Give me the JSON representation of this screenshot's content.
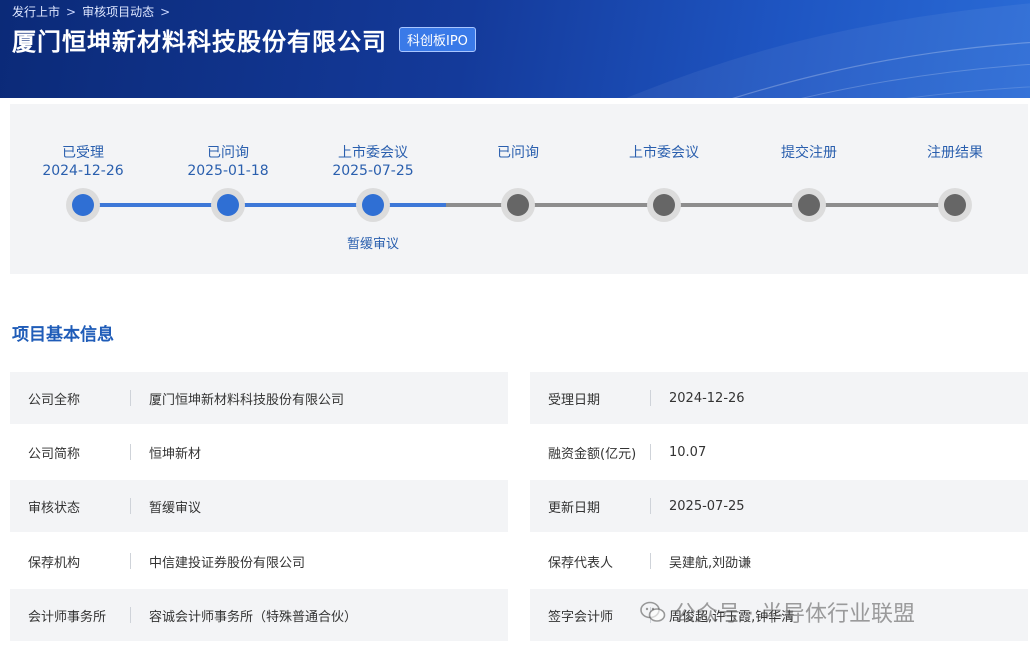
{
  "breadcrumb": [
    "发行上市",
    "审核项目动态"
  ],
  "header": {
    "company_name": "厦门恒坤新材料科技股份有限公司",
    "board_tag": "科创板IPO"
  },
  "timeline": {
    "steps": [
      {
        "label": "已受理",
        "date": "2024-12-26",
        "status": "done"
      },
      {
        "label": "已问询",
        "date": "2025-01-18",
        "status": "done"
      },
      {
        "label": "上市委会议",
        "date": "2025-07-25",
        "status": "done",
        "note": "暂缓审议"
      },
      {
        "label": "已问询",
        "date": "",
        "status": "todo"
      },
      {
        "label": "上市委会议",
        "date": "",
        "status": "todo"
      },
      {
        "label": "提交注册",
        "date": "",
        "status": "todo"
      },
      {
        "label": "注册结果",
        "date": "",
        "status": "todo"
      }
    ],
    "colors": {
      "done": "#2f6fd4",
      "todo": "#666666"
    }
  },
  "section": {
    "title": "项目基本信息"
  },
  "info": {
    "left": [
      {
        "key": "公司全称",
        "value": "厦门恒坤新材料科技股份有限公司"
      },
      {
        "key": "公司简称",
        "value": "恒坤新材"
      },
      {
        "key": "审核状态",
        "value": "暂缓审议"
      },
      {
        "key": "保荐机构",
        "value": "中信建投证券股份有限公司"
      },
      {
        "key": "会计师事务所",
        "value": "容诚会计师事务所（特殊普通合伙）"
      }
    ],
    "right": [
      {
        "key": "受理日期",
        "value": "2024-12-26"
      },
      {
        "key": "融资金额(亿元)",
        "value": "10.07"
      },
      {
        "key": "更新日期",
        "value": "2025-07-25"
      },
      {
        "key": "保荐代表人",
        "value": "吴建航,刘劭谦"
      },
      {
        "key": "签字会计师",
        "value": "周俊超,许玉霞,钟华清"
      }
    ]
  },
  "watermark": {
    "text": "公众号 · 半导体行业联盟",
    "icon": "wechat-icon"
  }
}
